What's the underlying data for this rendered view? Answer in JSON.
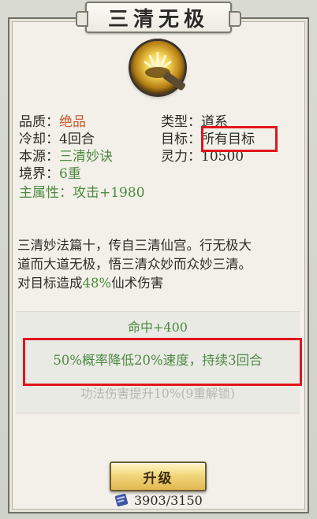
{
  "title": "三清无极",
  "icon": "golden-sun-skill-icon",
  "attributes": {
    "quality": {
      "label": "品质：",
      "value": "绝品"
    },
    "type": {
      "label": "类型：",
      "value": "道系"
    },
    "cooldown": {
      "label": "冷却：",
      "value": "4回合"
    },
    "target": {
      "label": "目标：",
      "value": "所有目标"
    },
    "origin": {
      "label": "本源：",
      "value": "三清妙诀"
    },
    "spirit": {
      "label": "灵力：",
      "value": "10500"
    },
    "realm": {
      "label": "境界：",
      "value": "6重"
    },
    "main_attr": {
      "label": "主属性：",
      "value": "攻击+1980"
    }
  },
  "description": {
    "line1": "三清妙法篇十，传自三清仙宫。行无极大",
    "line2": "道而大道无极，悟三清众妙而众妙三清。",
    "line3_prefix": "对目标造成",
    "line3_pct": "48%",
    "line3_suffix": "仙术伤害"
  },
  "effects": {
    "hit": "命中+400",
    "speed_debuff": "50%概率降低20%速度，持续3回合",
    "locked": "功法伤害提升10%(9重解锁)"
  },
  "upgrade": {
    "label": "升级"
  },
  "cost": {
    "current": "3903",
    "required": "3150",
    "text": "3903/3150",
    "icon": "scroll-icon"
  },
  "colors": {
    "highlight": "#e3141e",
    "green": "#4d8a43",
    "quality_red": "#c85a2e",
    "button_gold": "#f2d77d"
  }
}
